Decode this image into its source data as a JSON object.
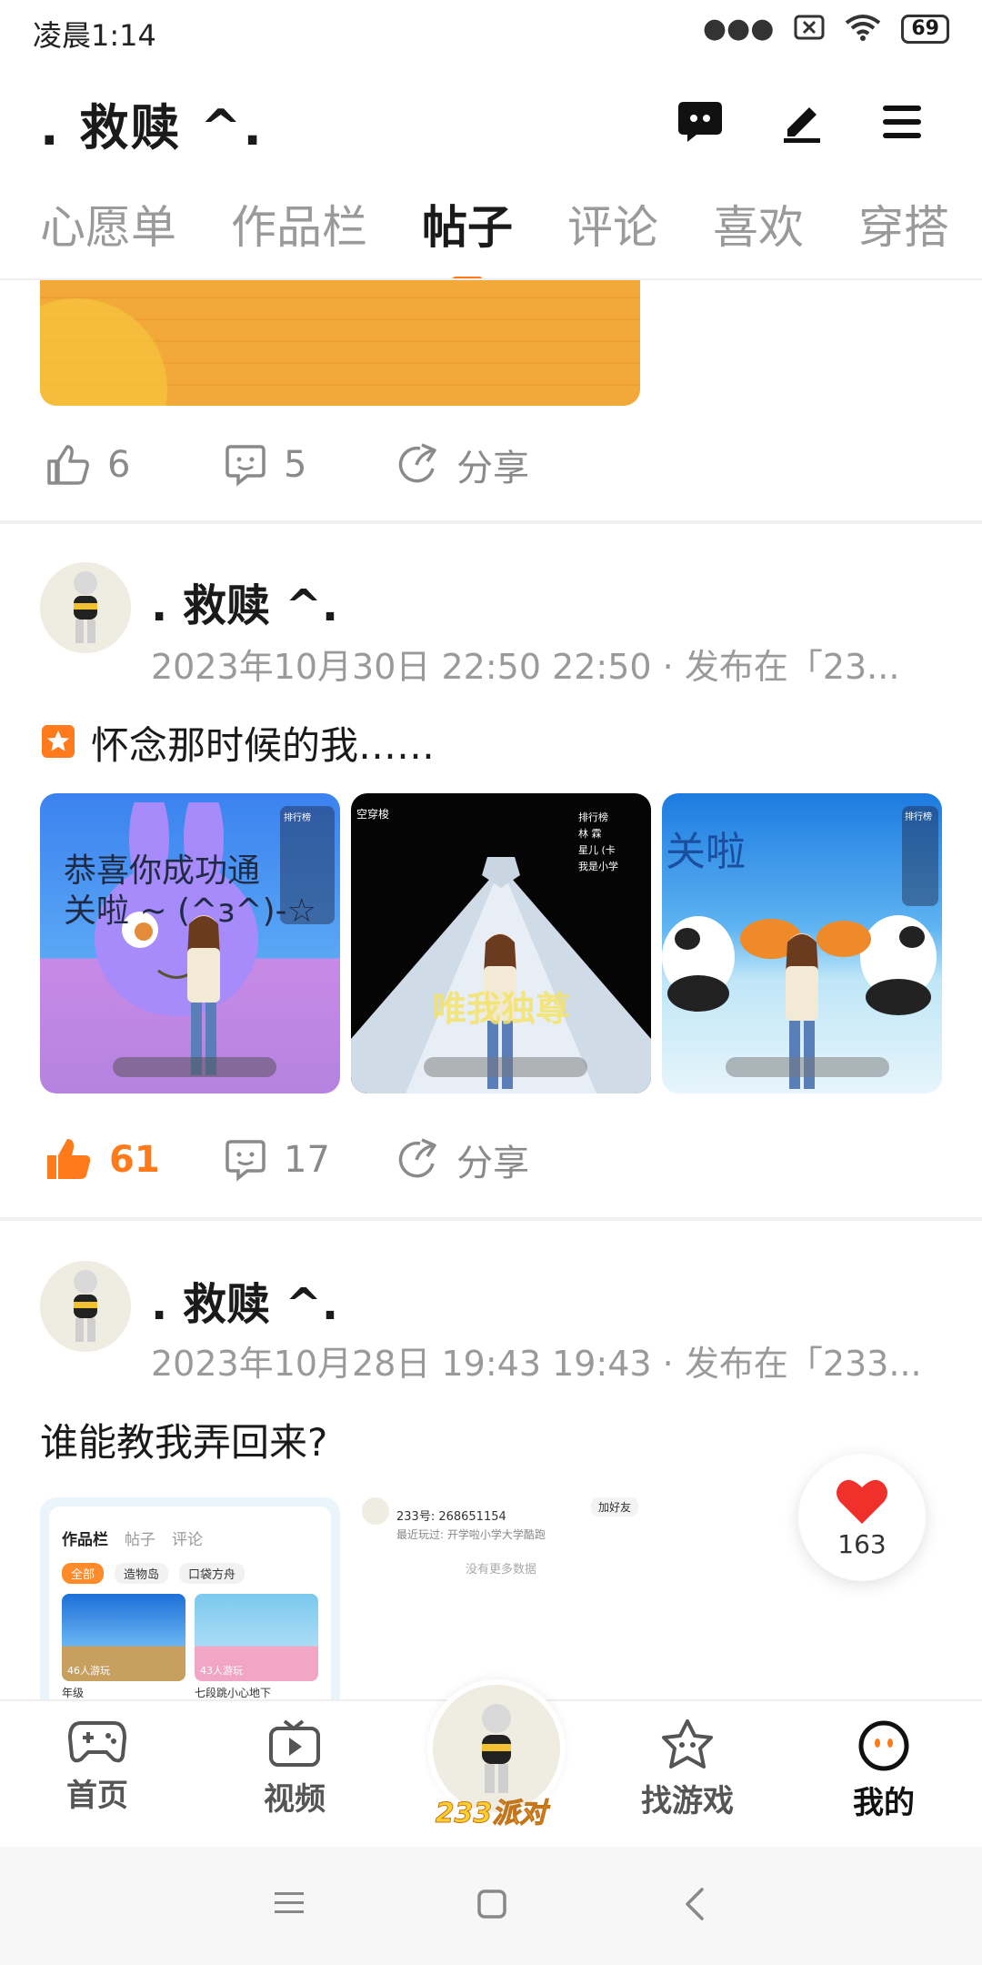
{
  "status_bar": {
    "time": "凌晨1:14",
    "battery": "69"
  },
  "header": {
    "title": ". 救赎 ^."
  },
  "tabs": [
    {
      "label": "心愿单"
    },
    {
      "label": "作品栏"
    },
    {
      "label": "帖子"
    },
    {
      "label": "评论"
    },
    {
      "label": "喜欢"
    },
    {
      "label": "穿搭"
    }
  ],
  "post0": {
    "likes": "6",
    "comments": "5",
    "share": "分享"
  },
  "post1": {
    "author": ". 救赎 ^.",
    "meta": "2023年10月30日 22:50 22:50 · 发布在「23...",
    "text": "怀念那时候的我……",
    "likes": "61",
    "comments": "17",
    "share": "分享",
    "img1": {
      "caption_top": "恭喜你成功通",
      "caption_bottom": "关啦 ~ (^з^)-☆",
      "rank_title": "排行榜"
    },
    "img2": {
      "label": "唯我独尊",
      "rank_title": "排行榜",
      "rank_items": [
        "林 霖",
        "星儿 (卡",
        "我是小学"
      ],
      "corner": "空穿梭"
    },
    "img3": {
      "caption": "关啦",
      "rank_title": "排行榜"
    }
  },
  "post2": {
    "author": ". 救赎 ^.",
    "meta": "2023年10月28日 19:43 19:43 · 发布在「233...",
    "text": "谁能教我弄回来?",
    "shot1": {
      "tabs": [
        "作品栏",
        "帖子",
        "评论"
      ],
      "chips": [
        "全部",
        "造物岛",
        "口袋方舟"
      ],
      "card1_count": "46人游玩",
      "card1_name": "年级",
      "card2_count": "43人游玩",
      "card2_name": "七段跳小心地下"
    },
    "shot2": {
      "id_line": "233号: 268651154",
      "recent": "最近玩过: 开学啦小学大学酷跑",
      "add_friend": "加好友",
      "empty": "没有更多数据"
    }
  },
  "float_like": {
    "count": "163"
  },
  "bottom_nav": [
    {
      "label": "首页"
    },
    {
      "label": "视频"
    },
    {
      "label": "233派对"
    },
    {
      "label": "找游戏"
    },
    {
      "label": "我的"
    }
  ],
  "colors": {
    "accent": "#ff7a1a",
    "like_red": "#f0302a"
  }
}
